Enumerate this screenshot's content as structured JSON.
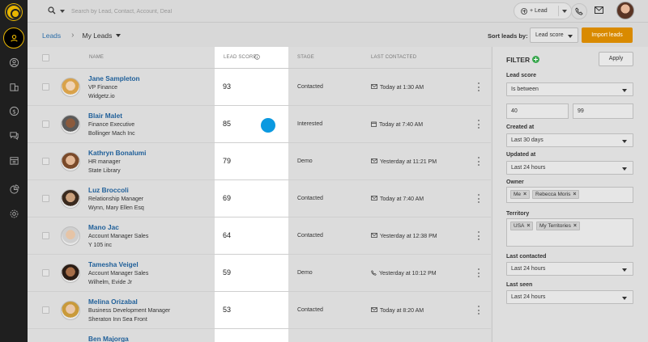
{
  "topbar": {
    "search_placeholder": "Search by Lead, Contact, Account, Deal",
    "lead_button_label": "+ Lead"
  },
  "header": {
    "breadcrumb_root": "Leads",
    "current_view": "My Leads",
    "sort_label": "Sort leads by:",
    "sort_value": "Lead score",
    "import_label": "Import leads"
  },
  "table": {
    "columns": {
      "name": "NAME",
      "score": "LEAD SCORE",
      "stage": "STAGE",
      "last_contacted": "LAST CONTACTED"
    },
    "rows": [
      {
        "name": "Jane Sampleton",
        "title": "VP Finance",
        "company": "Widgetz.io",
        "score": "93",
        "stage": "Contacted",
        "last_contacted": "Today at 1:30 AM",
        "contact_icon": "mail-icon"
      },
      {
        "name": "Blair Malet",
        "title": "Finance Executive",
        "company": "Bollinger Mach Inc",
        "score": "85",
        "stage": "Interested",
        "last_contacted": "Today at 7:40 AM",
        "contact_icon": "calendar-icon"
      },
      {
        "name": "Kathryn Bonalumi",
        "title": "HR manager",
        "company": "State Library",
        "score": "79",
        "stage": "Demo",
        "last_contacted": "Yesterday at 11:21 PM",
        "contact_icon": "mail-icon"
      },
      {
        "name": "Luz Broccoli",
        "title": "Relationship Manager",
        "company": "Wynn, Mary Ellen Esq",
        "score": "69",
        "stage": "Contacted",
        "last_contacted": "Today at 7:40 AM",
        "contact_icon": "mail-icon"
      },
      {
        "name": "Mano Jac",
        "title": "Account Manager Sales",
        "company": "Y 105 inc",
        "score": "64",
        "stage": "Contacted",
        "last_contacted": "Yesterday at 12:38 PM",
        "contact_icon": "mail-icon"
      },
      {
        "name": "Tamesha Veigel",
        "title": "Account Manager Sales",
        "company": "Wilhelm, Evide Jr",
        "score": "59",
        "stage": "Demo",
        "last_contacted": "Yesterday at 10:12 PM",
        "contact_icon": "phone-icon"
      },
      {
        "name": "Melina Orizabal",
        "title": "Business Development Manager",
        "company": "Sheraton Inn Sea Front",
        "score": "53",
        "stage": "Contacted",
        "last_contacted": "Today at 8:20 AM",
        "contact_icon": "mail-icon"
      },
      {
        "name": "Ben Majorga",
        "title": "",
        "company": "",
        "score": "",
        "stage": "",
        "last_contacted": "",
        "contact_icon": ""
      }
    ]
  },
  "filter": {
    "title": "FILTER",
    "apply_label": "Apply",
    "lead_score_label": "Lead score",
    "lead_score_operator": "Is between",
    "lead_score_min": "40",
    "lead_score_max": "99",
    "created_at_label": "Created at",
    "created_at_value": "Last 30 days",
    "updated_at_label": "Updated at",
    "updated_at_value": "Last 24 hours",
    "owner_label": "Owner",
    "owner_tags": [
      "Me",
      "Rebecca Moris"
    ],
    "territory_label": "Territory",
    "territory_tags": [
      "USA",
      "My Territories"
    ],
    "last_contacted_label": "Last contacted",
    "last_contacted_value": "Last 24 hours",
    "last_seen_label": "Last seen",
    "last_seen_value": "Last 24 hours"
  },
  "colors": {
    "accent": "#d98a00",
    "link": "#1f5f99",
    "rail": "#1f1f1f",
    "cursor_dot": "#0b99e0"
  }
}
